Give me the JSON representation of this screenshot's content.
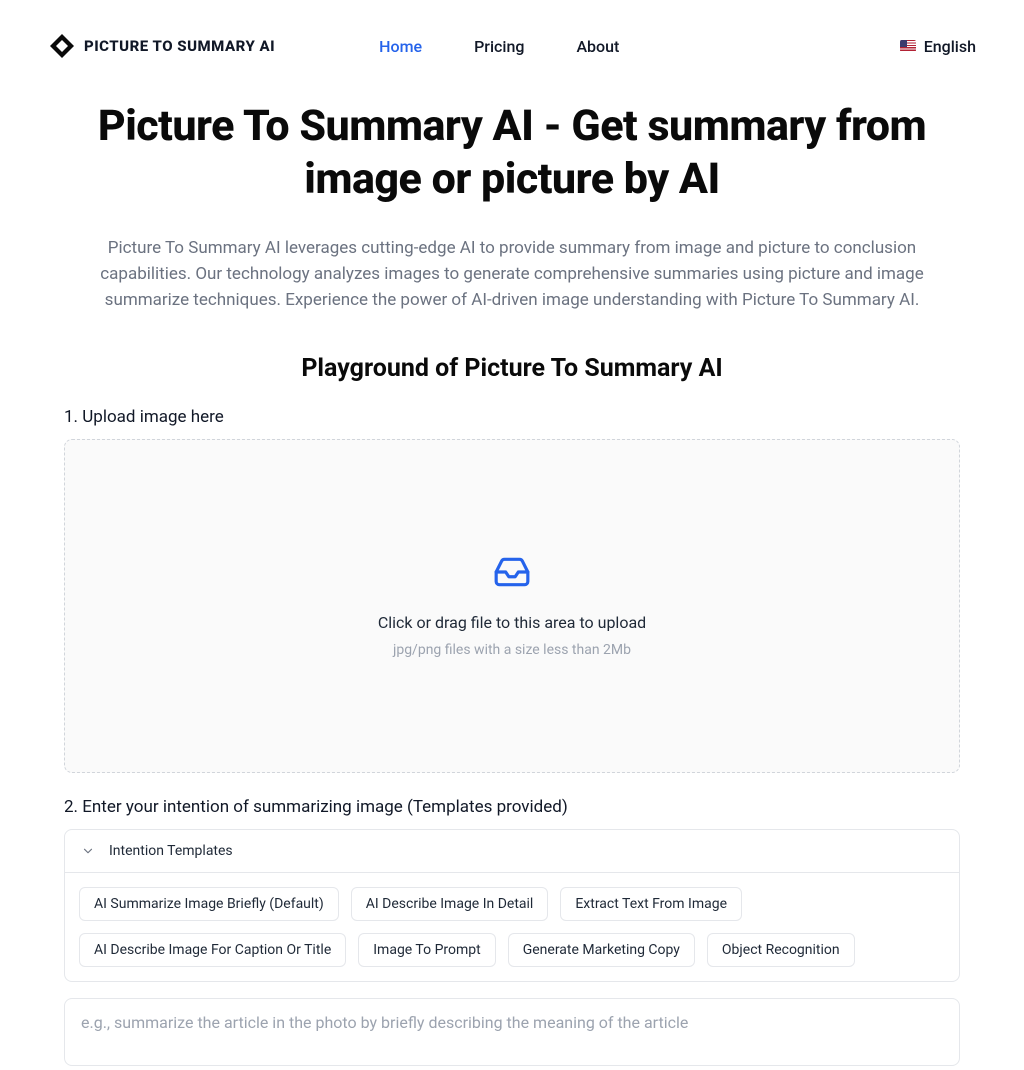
{
  "header": {
    "logo_text": "PICTURE TO SUMMARY AI",
    "nav": {
      "home": "Home",
      "pricing": "Pricing",
      "about": "About"
    },
    "lang_label": "English"
  },
  "hero": {
    "title": "Picture To Summary AI - Get summary from image or picture by AI",
    "description": "Picture To Summary AI leverages cutting-edge AI to provide summary from image and picture to conclusion capabilities. Our technology analyzes images to generate comprehensive summaries using picture and image summarize techniques. Experience the power of AI-driven image understanding with Picture To Summary AI."
  },
  "playground": {
    "title": "Playground of Picture To Summary AI",
    "step1_label": "1. Upload image here",
    "upload_main": "Click or drag file to this area to upload",
    "upload_sub": "jpg/png files with a size less than 2Mb",
    "step2_label": "2. Enter your intention of summarizing image (Templates provided)",
    "templates_header": "Intention Templates",
    "templates": [
      "AI Summarize Image Briefly (Default)",
      "AI Describe Image In Detail",
      "Extract Text From Image",
      "AI Describe Image For Caption Or Title",
      "Image To Prompt",
      "Generate Marketing Copy",
      "Object Recognition"
    ],
    "textarea_placeholder": "e.g., summarize the article in the photo by briefly describing the meaning of the article"
  }
}
